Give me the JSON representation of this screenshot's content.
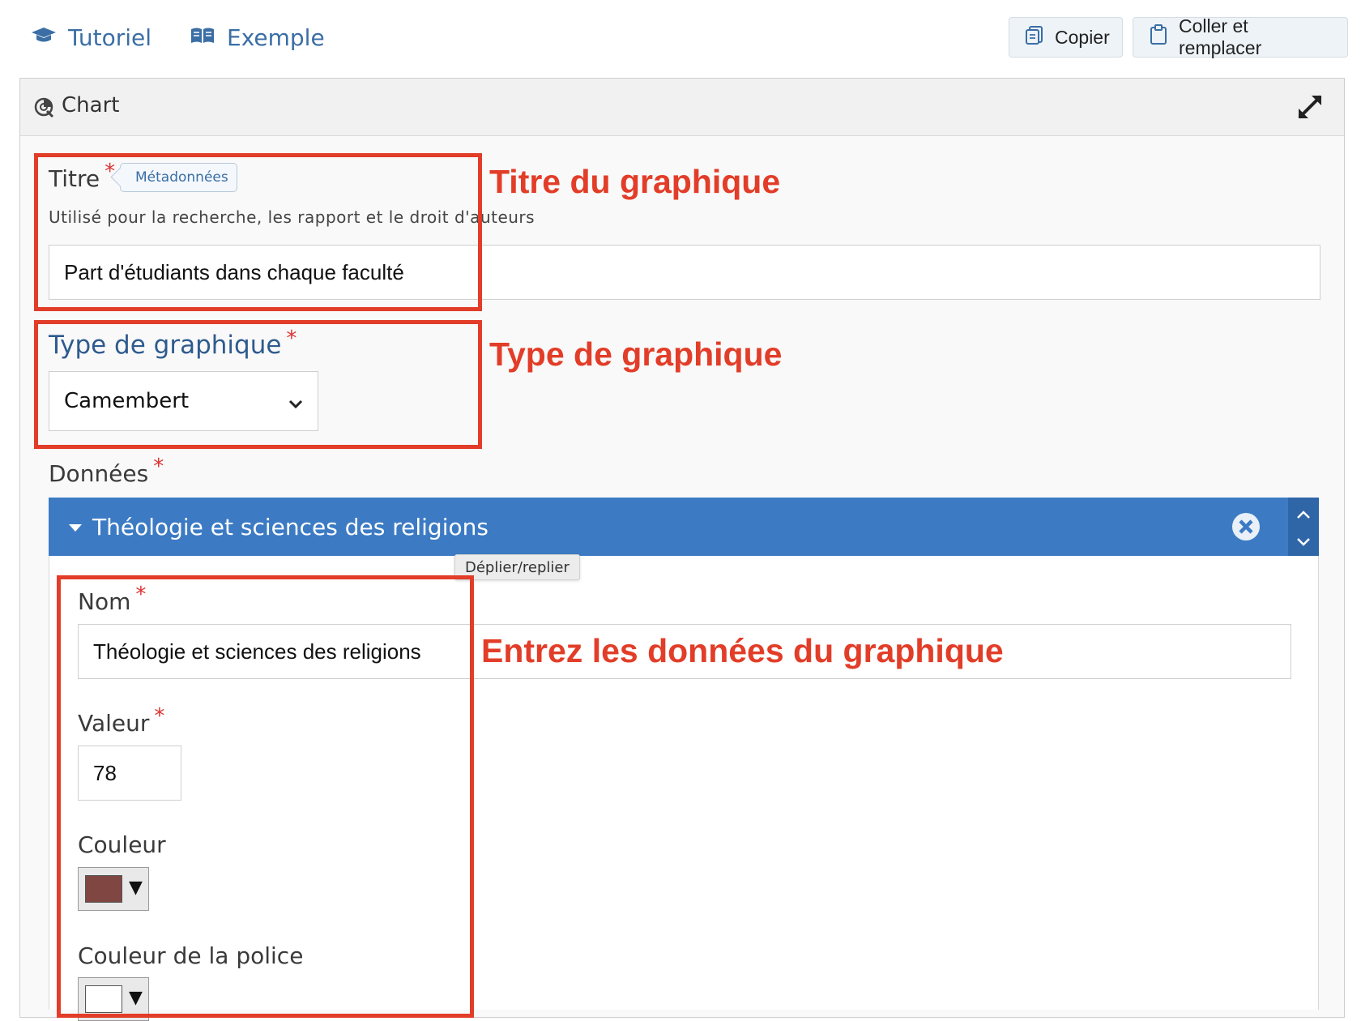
{
  "toolbar": {
    "tutorial_label": "Tutoriel",
    "example_label": "Exemple",
    "copy_label": "Copier",
    "paste_replace_label": "Coller et remplacer"
  },
  "panel": {
    "title": "Chart"
  },
  "fields": {
    "title_label": "Titre",
    "required_mark": "*",
    "metadata_badge": "Métadonnées",
    "title_help": "Utilisé pour la recherche, les rapport et le droit d'auteurs",
    "title_value": "Part d'étudiants dans chaque faculté",
    "type_label": "Type de graphique",
    "type_value": "Camembert",
    "data_label": "Données"
  },
  "data_item": {
    "header": "Théologie et sciences des religions",
    "toggle_tooltip": "Déplier/replier",
    "name_label": "Nom",
    "name_value": "Théologie et sciences des religions",
    "value_label": "Valeur",
    "value_value": "78",
    "color_label": "Couleur",
    "color_value": "#7f4642",
    "font_color_label": "Couleur de la police",
    "font_color_value": "#ffffff"
  },
  "annotations": {
    "title": "Titre du graphique",
    "type": "Type de graphique",
    "data": "Entrez les données du graphique"
  },
  "colors": {
    "accent": "#3a6ea5",
    "item_header": "#3c7bc4",
    "annotation": "#e23d28",
    "required": "#dd3333"
  }
}
